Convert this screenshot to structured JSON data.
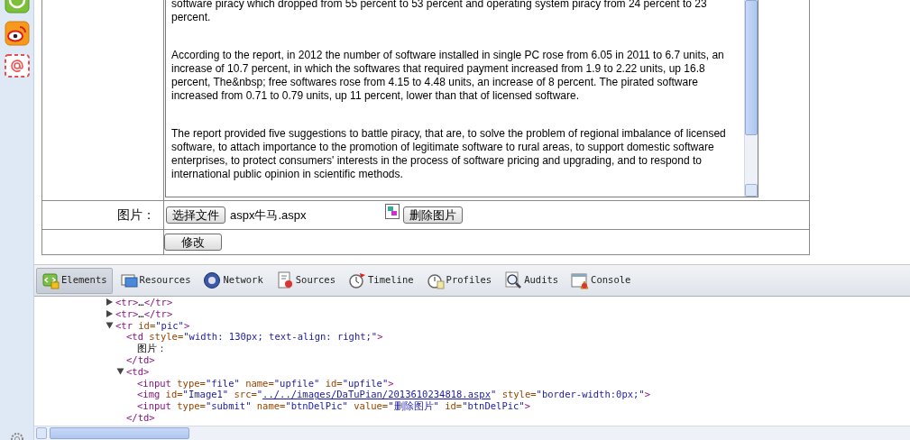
{
  "form": {
    "content": {
      "paragraphs": [
        "software piracy which dropped from 55 percent to 53 percent and operating system piracy from 24 percent to 23 percent.",
        "According to the report, in 2012 the number of software installed in single PC rose from 6.05 in 2011 to 6.7 units, an increase of 10.7 percent, in which the softwares that required payment increased from 1.9 to 2.22 units, up 16.8 percent, The&nbsp; free softwares rose from 4.15 to 4.48 units, an increase of 8 percent. The pirated software increased from 0.71 to 0.79 units, up 11 percent, lower than that of licensed software.",
        "The report provided five suggestions to battle piracy, that are, to solve the problem of regional imbalance of licensed software, to attach importance to the promotion of legitimate software to rural areas, to support domestic software enterprises, to protect consumers' interests in the process of software pricing and upgrading, and to respond to international public opinion in scientific methods."
      ]
    },
    "picture_row": {
      "label": "图片：",
      "choose_button": "选择文件",
      "file_name": "aspx牛马.aspx",
      "delete_button": "删除图片"
    },
    "submit_button": "修改"
  },
  "devtools": {
    "tabs": [
      {
        "label": "Elements",
        "selected": true,
        "kind": "elements"
      },
      {
        "label": "Resources",
        "selected": false,
        "kind": "resources"
      },
      {
        "label": "Network",
        "selected": false,
        "kind": "network"
      },
      {
        "label": "Sources",
        "selected": false,
        "kind": "sources"
      },
      {
        "label": "Timeline",
        "selected": false,
        "kind": "timeline"
      },
      {
        "label": "Profiles",
        "selected": false,
        "kind": "profiles"
      },
      {
        "label": "Audits",
        "selected": false,
        "kind": "audits"
      },
      {
        "label": "Console",
        "selected": false,
        "kind": "console"
      }
    ],
    "dom": [
      {
        "expanded": false,
        "line": [
          {
            "kind": "tag",
            "text": "<tr>"
          },
          {
            "kind": "plain",
            "text": "…"
          },
          {
            "kind": "tag",
            "text": "</tr>"
          }
        ]
      },
      {
        "expanded": false,
        "line": [
          {
            "kind": "tag",
            "text": "<tr>"
          },
          {
            "kind": "plain",
            "text": "…"
          },
          {
            "kind": "tag",
            "text": "</tr>"
          }
        ]
      },
      {
        "expanded": true,
        "line": [
          {
            "kind": "tag",
            "text": "<tr"
          },
          {
            "kind": "attr",
            "text": " id="
          },
          {
            "kind": "val",
            "text": "\"pic\""
          },
          {
            "kind": "tag",
            "text": ">"
          }
        ],
        "children": [
          {
            "line": [
              {
                "kind": "tag",
                "text": "<td"
              },
              {
                "kind": "attr",
                "text": " style="
              },
              {
                "kind": "val",
                "text": "\"width: 130px; text-align: right;\""
              },
              {
                "kind": "tag",
                "text": ">"
              }
            ],
            "children": [
              {
                "line": [
                  {
                    "kind": "plain",
                    "text": "图片："
                  }
                ]
              }
            ],
            "end": [
              {
                "kind": "tag",
                "text": "</td>"
              }
            ]
          },
          {
            "expanded": true,
            "line": [
              {
                "kind": "tag",
                "text": "<td>"
              }
            ],
            "children": [
              {
                "line": [
                  {
                    "kind": "tag",
                    "text": "<input"
                  },
                  {
                    "kind": "attr",
                    "text": " type="
                  },
                  {
                    "kind": "val",
                    "text": "\"file\""
                  },
                  {
                    "kind": "attr",
                    "text": " name="
                  },
                  {
                    "kind": "val",
                    "text": "\"upfile\""
                  },
                  {
                    "kind": "attr",
                    "text": " id="
                  },
                  {
                    "kind": "val",
                    "text": "\"upfile\""
                  },
                  {
                    "kind": "tag",
                    "text": ">"
                  }
                ]
              },
              {
                "line": [
                  {
                    "kind": "tag",
                    "text": "<img"
                  },
                  {
                    "kind": "attr",
                    "text": " id="
                  },
                  {
                    "kind": "val",
                    "text": "\"Image1\""
                  },
                  {
                    "kind": "attr",
                    "text": " src="
                  },
                  {
                    "kind": "val",
                    "text": "\""
                  },
                  {
                    "kind": "link",
                    "text": "../../images/DaTuPian/2013610234818.aspx"
                  },
                  {
                    "kind": "val",
                    "text": "\""
                  },
                  {
                    "kind": "attr",
                    "text": " style="
                  },
                  {
                    "kind": "val",
                    "text": "\"border-width:0px;\""
                  },
                  {
                    "kind": "tag",
                    "text": ">"
                  }
                ]
              },
              {
                "line": [
                  {
                    "kind": "tag",
                    "text": "<input"
                  },
                  {
                    "kind": "attr",
                    "text": " type="
                  },
                  {
                    "kind": "val",
                    "text": "\"submit\""
                  },
                  {
                    "kind": "attr",
                    "text": " name="
                  },
                  {
                    "kind": "val",
                    "text": "\"btnDelPic\""
                  },
                  {
                    "kind": "attr",
                    "text": " value="
                  },
                  {
                    "kind": "val",
                    "text": "\"删除图片\""
                  },
                  {
                    "kind": "attr",
                    "text": " id="
                  },
                  {
                    "kind": "val",
                    "text": "\"btnDelPic\""
                  },
                  {
                    "kind": "tag",
                    "text": ">"
                  }
                ]
              }
            ],
            "end": [
              {
                "kind": "tag",
                "text": "</td>"
              }
            ]
          }
        ]
      }
    ]
  }
}
